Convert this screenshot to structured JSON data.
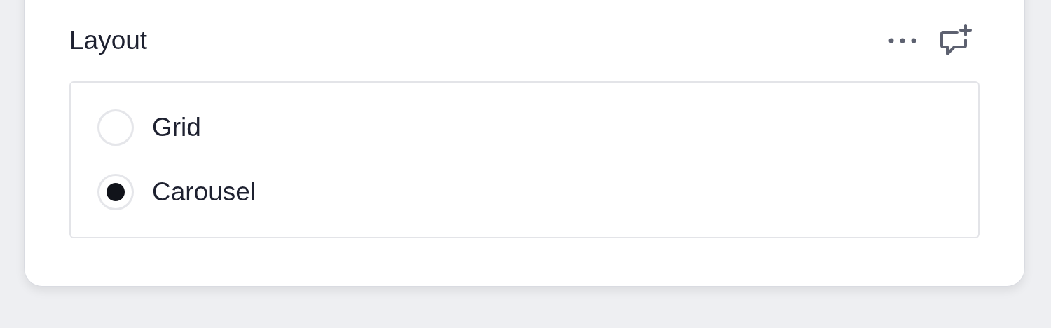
{
  "field": {
    "label": "Layout",
    "options": [
      {
        "label": "Grid",
        "selected": false
      },
      {
        "label": "Carousel",
        "selected": true
      }
    ]
  }
}
